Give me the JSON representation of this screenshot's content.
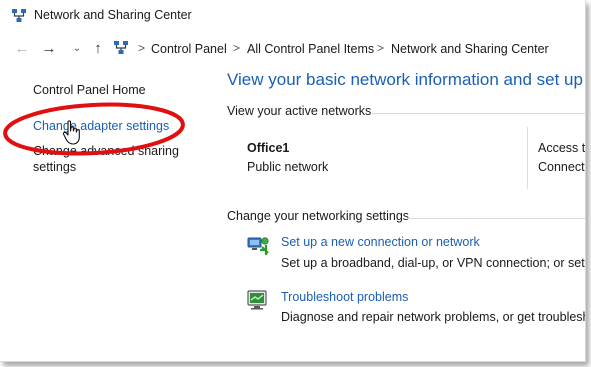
{
  "window": {
    "title": "Network and Sharing Center"
  },
  "nav": {
    "back_icon": "arrow-left-icon",
    "forward_icon": "arrow-right-icon",
    "recent_icon": "chevron-down-icon",
    "up_icon": "arrow-up-icon"
  },
  "breadcrumb": {
    "items": [
      "Control Panel",
      "All Control Panel Items",
      "Network and Sharing Center"
    ],
    "separator": ">"
  },
  "sidebar": {
    "home": "Control Panel Home",
    "adapter_link": "Change adapter settings",
    "sharing_link": "Change advanced sharing settings"
  },
  "main": {
    "heading": "View your basic network information and set up co",
    "active_networks_label": "View your active networks",
    "network": {
      "name": "Office1",
      "type": "Public network",
      "access_label": "Access ty",
      "connections_label": "Connecti"
    },
    "change_settings_label": "Change your networking settings",
    "tasks": [
      {
        "icon": "new-connection-icon",
        "link": "Set up a new connection or network",
        "description": "Set up a broadband, dial-up, or VPN connection; or set up"
      },
      {
        "icon": "troubleshoot-icon",
        "link": "Troubleshoot problems",
        "description": "Diagnose and repair network problems, or get troubleshoo"
      }
    ]
  },
  "colors": {
    "link": "#1a5fb4",
    "highlight": "#e01010"
  }
}
